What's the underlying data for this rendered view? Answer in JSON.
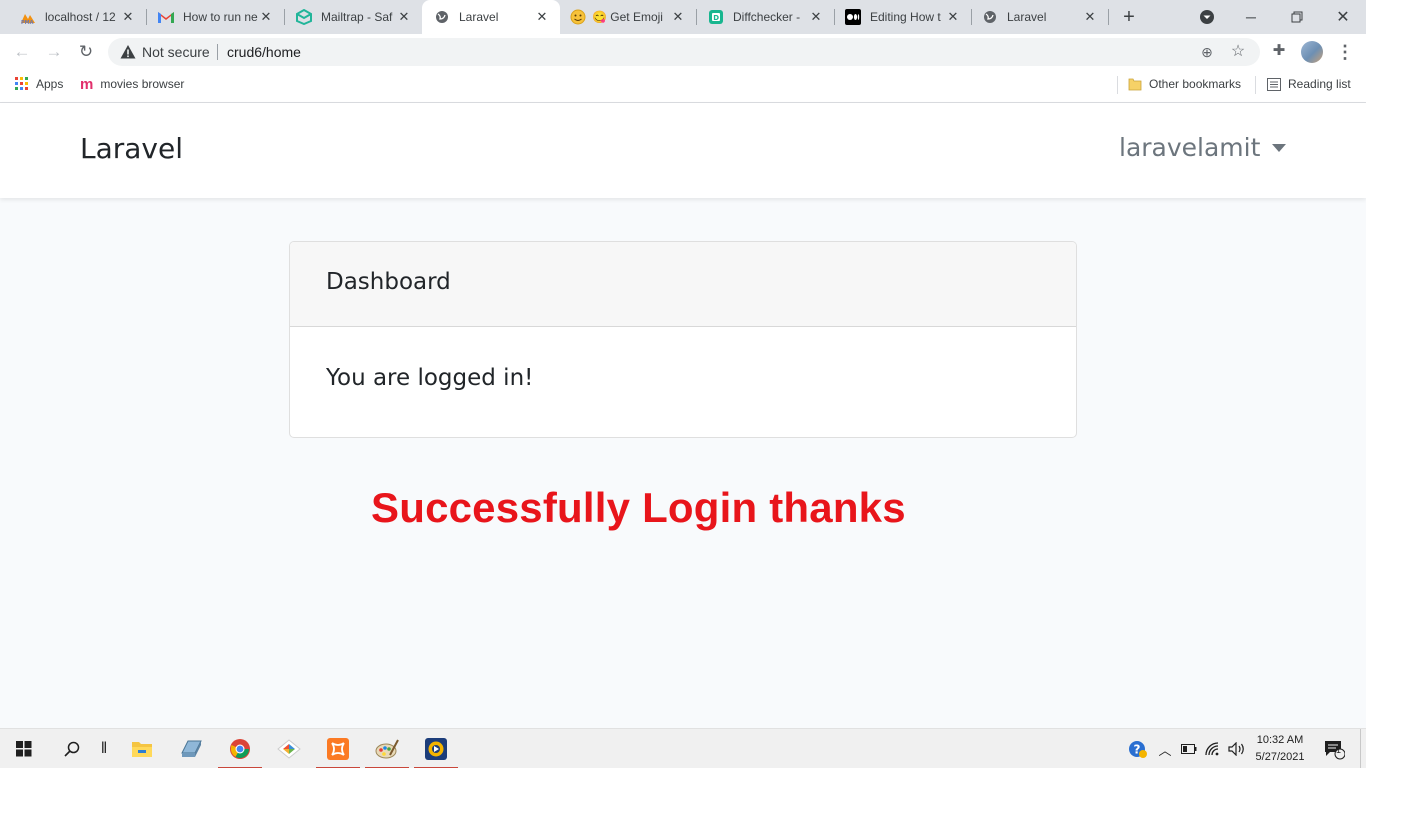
{
  "browser": {
    "tabs": [
      {
        "label": "localhost / 12",
        "favicon": "phpmyadmin-icon",
        "active": false
      },
      {
        "label": "How to run ne",
        "favicon": "gmail-icon",
        "active": false
      },
      {
        "label": "Mailtrap - Saf",
        "favicon": "mailtrap-icon",
        "active": false
      },
      {
        "label": "Laravel",
        "favicon": "globe-icon",
        "active": true
      },
      {
        "label": "😋 Get Emoji",
        "favicon": "emoji-icon",
        "active": false
      },
      {
        "label": "Diffchecker - ",
        "favicon": "diffchecker-icon",
        "active": false
      },
      {
        "label": "Editing How t",
        "favicon": "medium-icon",
        "active": false
      },
      {
        "label": "Laravel",
        "favicon": "globe-icon",
        "active": false
      }
    ],
    "address_bar": {
      "security_label": "Not secure",
      "url": "crud6/home"
    },
    "bookmarks": {
      "apps_label": "Apps",
      "items": [
        {
          "label": "movies browser"
        }
      ],
      "other_label": "Other bookmarks",
      "reading_list_label": "Reading list"
    }
  },
  "app": {
    "brand": "Laravel",
    "user_menu_label": "laravelamit",
    "card": {
      "header": "Dashboard",
      "body": "You are logged in!"
    },
    "annotation": "Successfully Login thanks"
  },
  "taskbar": {
    "apps": [
      "start-icon",
      "search-icon",
      "file-explorer-icon",
      "disk-icon",
      "chrome-icon",
      "git-icon",
      "xampp-icon",
      "paint-icon",
      "media-icon"
    ],
    "clock_time": "10:32 AM",
    "clock_date": "5/27/2021",
    "notification_count": "1"
  },
  "colors": {
    "annotation": "#e8151b",
    "page_bg": "#f8fafc",
    "tab_strip": "#dee1e6"
  }
}
